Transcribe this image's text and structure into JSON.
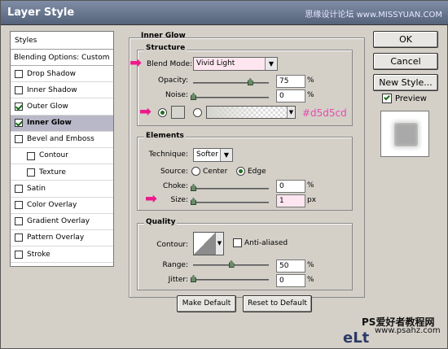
{
  "window": {
    "title": "Layer Style"
  },
  "watermark": {
    "top": "思缘设计论坛 www.MISSYUAN.COM",
    "bottom_line1": "PS爱好者教程网",
    "bottom_line2": "www.psahz.com",
    "logo": "eLt"
  },
  "styles_panel": {
    "header": "Styles",
    "blending_options": "Blending Options: Custom",
    "items": [
      {
        "label": "Drop Shadow",
        "checked": false,
        "active": false,
        "sub": false
      },
      {
        "label": "Inner Shadow",
        "checked": false,
        "active": false,
        "sub": false
      },
      {
        "label": "Outer Glow",
        "checked": true,
        "active": false,
        "sub": false
      },
      {
        "label": "Inner Glow",
        "checked": true,
        "active": true,
        "sub": false
      },
      {
        "label": "Bevel and Emboss",
        "checked": false,
        "active": false,
        "sub": false
      },
      {
        "label": "Contour",
        "checked": false,
        "active": false,
        "sub": true
      },
      {
        "label": "Texture",
        "checked": false,
        "active": false,
        "sub": true
      },
      {
        "label": "Satin",
        "checked": false,
        "active": false,
        "sub": false
      },
      {
        "label": "Color Overlay",
        "checked": false,
        "active": false,
        "sub": false
      },
      {
        "label": "Gradient Overlay",
        "checked": false,
        "active": false,
        "sub": false
      },
      {
        "label": "Pattern Overlay",
        "checked": false,
        "active": false,
        "sub": false
      },
      {
        "label": "Stroke",
        "checked": false,
        "active": false,
        "sub": false
      }
    ]
  },
  "inner_glow": {
    "title": "Inner Glow",
    "structure": {
      "title": "Structure",
      "blend_mode_label": "Blend Mode:",
      "blend_mode_value": "Vivid Light",
      "opacity_label": "Opacity:",
      "opacity_value": "75",
      "opacity_level": 0.75,
      "noise_label": "Noise:",
      "noise_value": "0",
      "noise_level": 0.0,
      "color_hex": "#d5d5cd",
      "percent": "%"
    },
    "elements": {
      "title": "Elements",
      "technique_label": "Technique:",
      "technique_value": "Softer",
      "source_label": "Source:",
      "source_center": "Center",
      "source_edge": "Edge",
      "choke_label": "Choke:",
      "choke_value": "0",
      "choke_level": 0.0,
      "size_label": "Size:",
      "size_value": "1",
      "size_level": 0.0,
      "px": "px"
    },
    "quality": {
      "title": "Quality",
      "contour_label": "Contour:",
      "anti_aliased_label": "Anti-aliased",
      "range_label": "Range:",
      "range_value": "50",
      "range_level": 0.5,
      "jitter_label": "Jitter:",
      "jitter_value": "0",
      "jitter_level": 0.0
    },
    "make_default": "Make Default",
    "reset_default": "Reset to Default"
  },
  "buttons": {
    "ok": "OK",
    "cancel": "Cancel",
    "new_style": "New Style...",
    "preview": "Preview"
  },
  "colors": {
    "accent_arrow": "#ee1a8c",
    "glow": "#d5d5cd",
    "pink_field": "#fde6f0"
  }
}
